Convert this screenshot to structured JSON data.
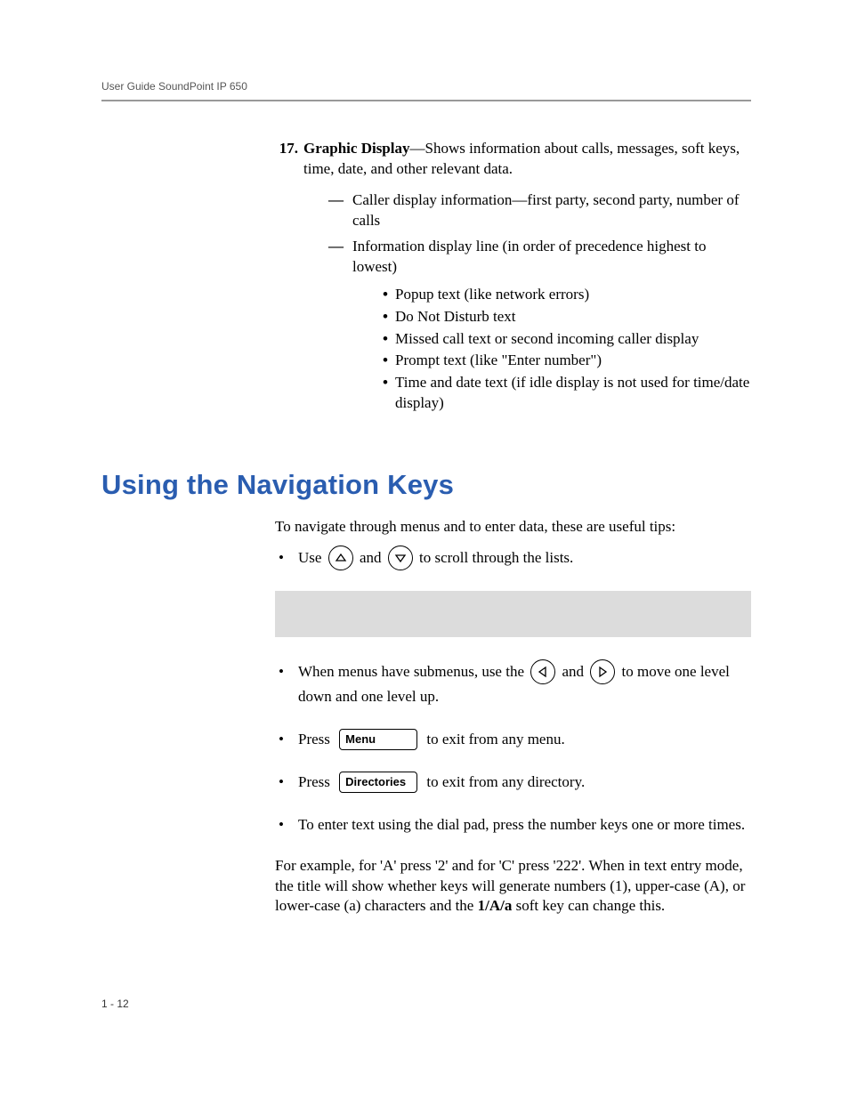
{
  "header": "User Guide SoundPoint IP 650",
  "item17": {
    "number": "17.",
    "lead": "Graphic Display",
    "rest": "—Shows information about calls, messages, soft keys, time, date, and other relevant data.",
    "dash1": "Caller display information—first party, second party, number of calls",
    "dash2": "Information display line (in order of precedence highest to lowest)",
    "b1": "Popup text (like network errors)",
    "b2": "Do Not Disturb text",
    "b3": "Missed call text or second incoming caller display",
    "b4": "Prompt text (like \"Enter number\")",
    "b5": "Time and date text (if idle display is not used for time/date display)"
  },
  "section": "Using the Navigation Keys",
  "intro": "To navigate through menus and to enter data, these are useful tips:",
  "tip1": {
    "pre": "Use ",
    "mid": " and ",
    "post": " to scroll through the lists."
  },
  "tip2": {
    "pre": "When menus have submenus, use the ",
    "mid": " and ",
    "post": "  to move one level down and one level up."
  },
  "tip3": {
    "pre": "Press ",
    "btn": "Menu",
    "post": " to exit from any menu."
  },
  "tip4": {
    "pre": "Press ",
    "btn": "Directories",
    "post": " to exit from any directory."
  },
  "tip5": "To enter text using the dial pad, press the number keys one or more times.",
  "example_pre": "For example, for 'A' press '2' and for 'C' press '222'. When in text entry mode, the title will show whether keys will generate numbers (1), upper-case (A), or lower-case (a) characters and the ",
  "example_bold": "1/A/a",
  "example_post": " soft key can change this.",
  "page_number": "1 - 12"
}
